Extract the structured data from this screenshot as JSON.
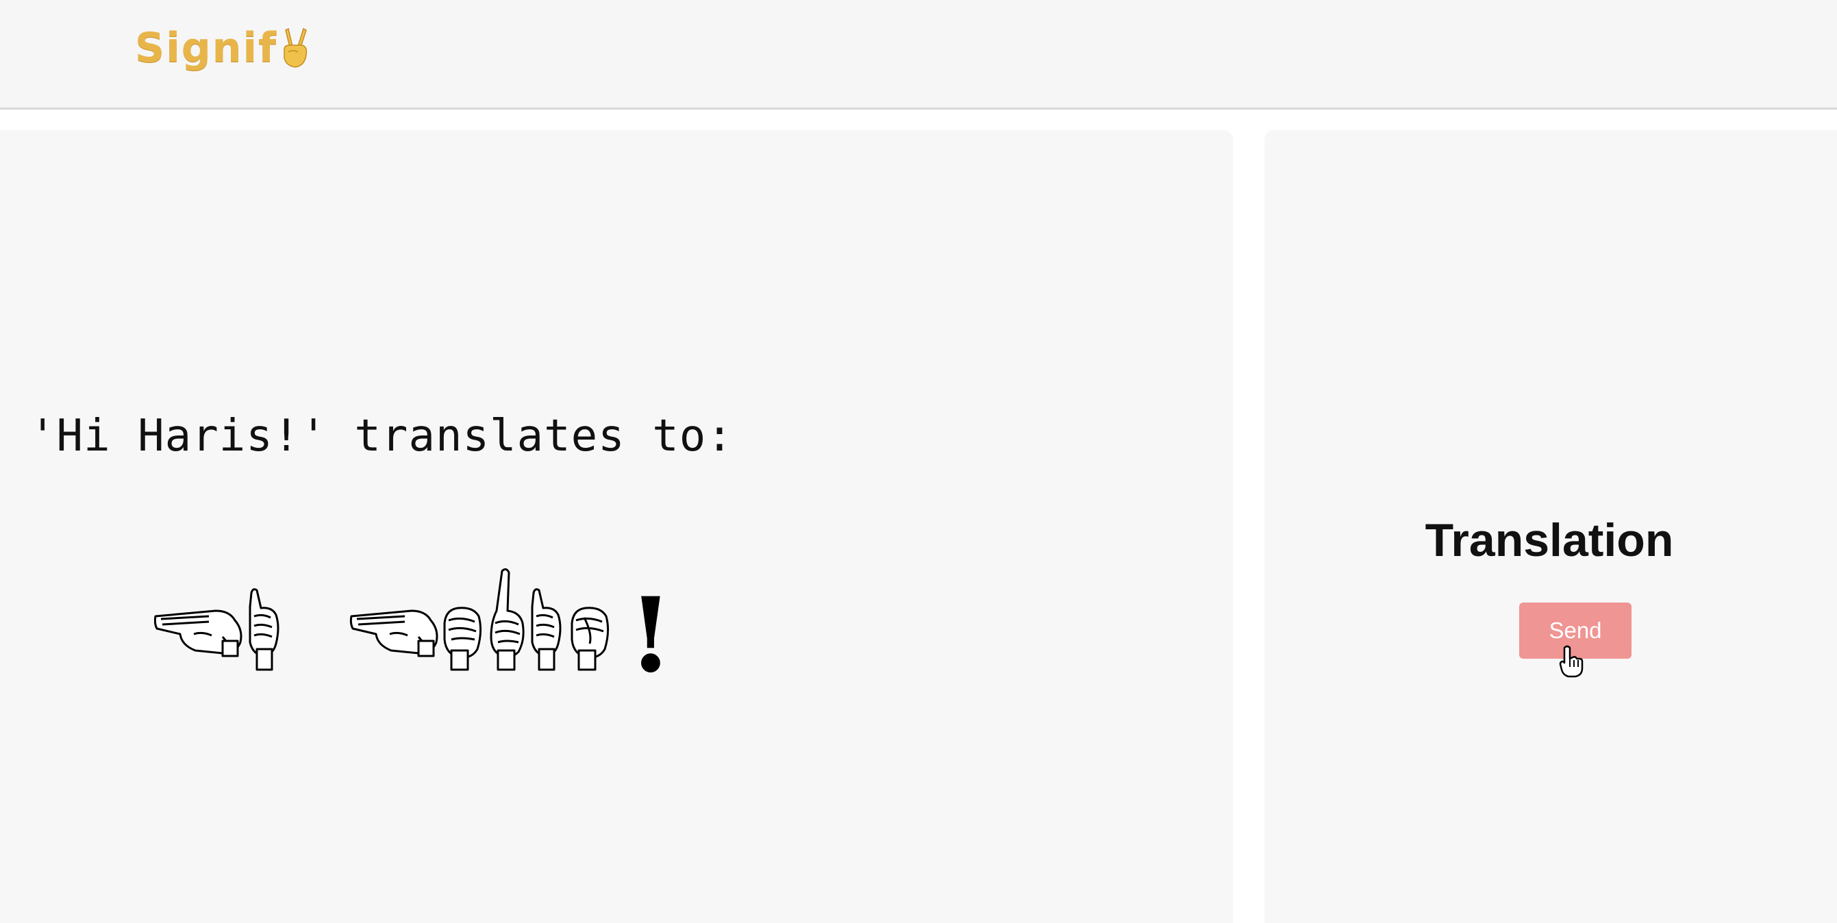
{
  "header": {
    "logo_text": "Signif",
    "logo_icon": "victory-hand-icon",
    "colors": {
      "logo": "#e8b54a",
      "header_bg": "#f6f6f6"
    }
  },
  "main": {
    "phrase": "'Hi Haris!' translates to:",
    "sign_sequence": [
      "H",
      "I",
      " ",
      "H",
      "A",
      "R",
      "I",
      "S",
      "!"
    ],
    "exclamation": "!"
  },
  "sidebar": {
    "title": "Translation",
    "send_label": "Send",
    "colors": {
      "button": "#ef9593",
      "panel_bg": "#f7f7f7"
    }
  }
}
